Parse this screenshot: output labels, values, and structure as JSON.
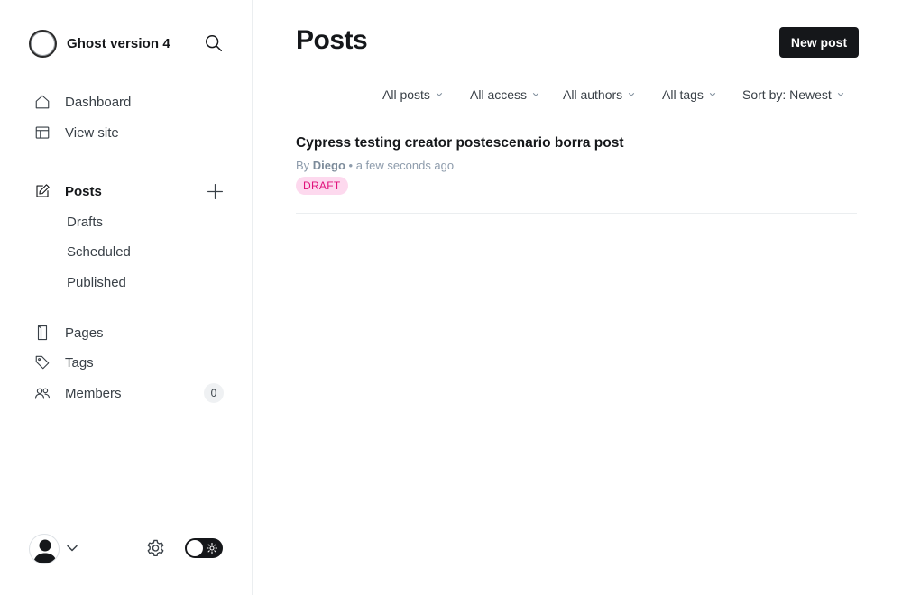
{
  "sidebar": {
    "brand": {
      "name": "Ghost version 4"
    },
    "nav_top": [
      {
        "label": "Dashboard",
        "icon": "home-icon"
      },
      {
        "label": "View site",
        "icon": "layout-icon"
      }
    ],
    "posts": {
      "label": "Posts",
      "icon": "pencil-icon",
      "sub": [
        "Drafts",
        "Scheduled",
        "Published"
      ]
    },
    "nav_bottom": [
      {
        "label": "Pages",
        "icon": "page-icon"
      },
      {
        "label": "Tags",
        "icon": "tag-icon"
      },
      {
        "label": "Members",
        "icon": "members-icon",
        "count": "0"
      }
    ]
  },
  "main": {
    "title": "Posts",
    "new_post_label": "New post",
    "filters": [
      "All posts",
      "All access",
      "All authors",
      "All tags",
      "Sort by: Newest"
    ],
    "posts": [
      {
        "title": "Cypress testing creator postescenario borra post",
        "by": "By",
        "author": "Diego",
        "time": "• a few seconds ago",
        "status": "DRAFT"
      }
    ]
  },
  "colors": {
    "accent_dark": "#15171a",
    "draft_bg": "#fdd9ee",
    "draft_text": "#e0127b"
  }
}
